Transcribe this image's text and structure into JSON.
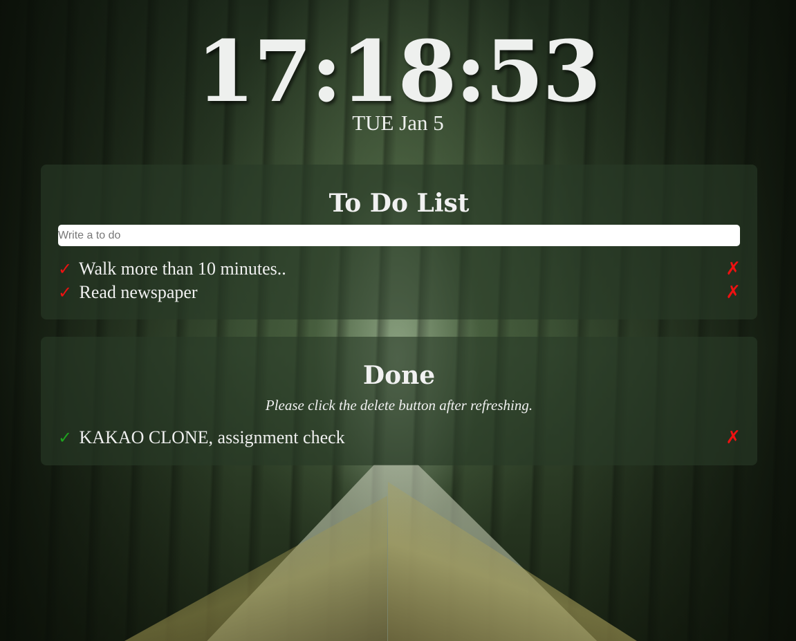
{
  "clock": {
    "time": "17:18:53",
    "date": "TUE Jan 5"
  },
  "todo": {
    "title": "To Do List",
    "input_placeholder": "Write a to do",
    "items": [
      {
        "check_glyph": "✓",
        "text": "Walk more than 10 minutes..",
        "delete_glyph": "✗"
      },
      {
        "check_glyph": "✓",
        "text": "Read newspaper",
        "delete_glyph": "✗"
      }
    ]
  },
  "done": {
    "title": "Done",
    "notice": "Please click the delete button after refreshing.",
    "items": [
      {
        "check_glyph": "✓",
        "text": "KAKAO CLONE, assignment check",
        "delete_glyph": "✗"
      }
    ]
  },
  "colors": {
    "todo_check": "#e11111",
    "done_check": "#1fa31f",
    "delete": "#e11111",
    "panel_bg": "rgba(40,58,38,0.62)"
  }
}
